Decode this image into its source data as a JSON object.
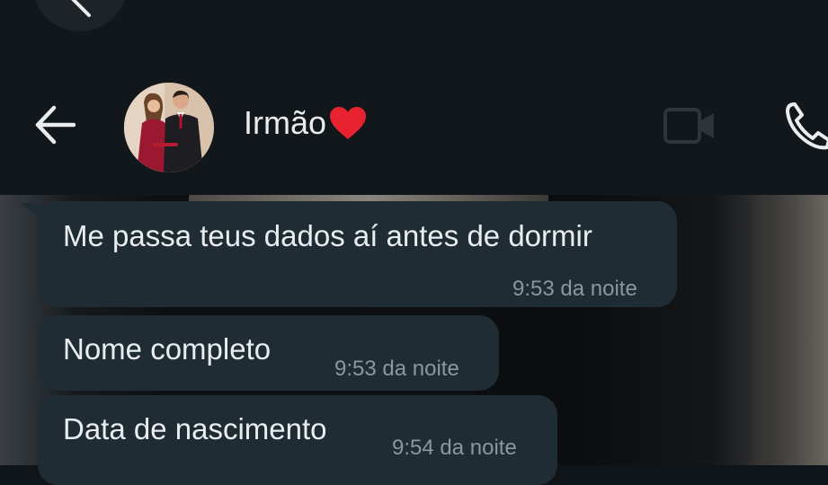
{
  "header": {
    "contact_name": "Irmão",
    "heart_icon": "red-heart-emoji",
    "icons": [
      "back-arrow-icon",
      "video-call-icon",
      "voice-call-icon"
    ]
  },
  "messages": [
    {
      "text": "Me passa teus dados aí antes de dormir",
      "time": "9:53 da noite"
    },
    {
      "text": "Nome completo",
      "time": "9:53 da noite"
    },
    {
      "text": "Data de nascimento",
      "time": "9:54 da noite"
    }
  ],
  "colors": {
    "bubble": "#202c33",
    "header": "#11171b",
    "text": "#e9edef",
    "time": "#8b979e"
  }
}
